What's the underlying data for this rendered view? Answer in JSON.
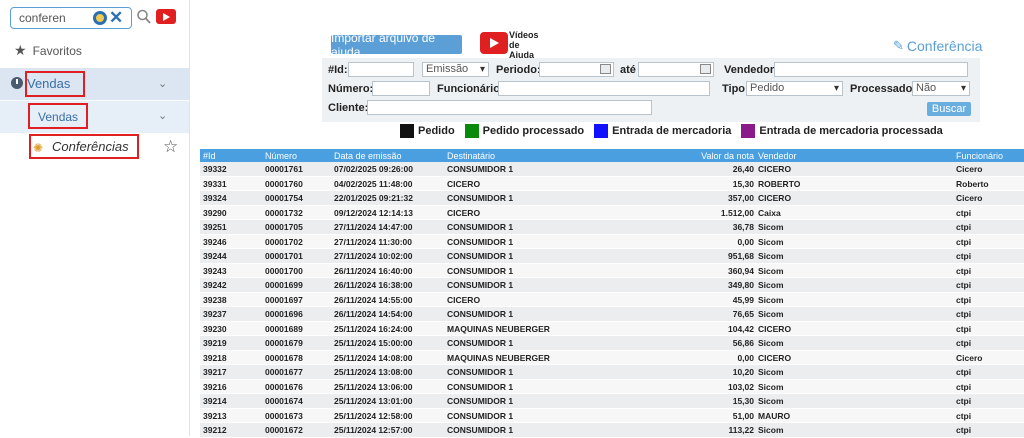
{
  "sidebar": {
    "search_value": "conferen",
    "favoritos": "Favoritos",
    "vendas": "Vendas",
    "vendas_sub": "Vendas",
    "conferencias": "Conferências"
  },
  "toolbar": {
    "import_label": "Importar arquivo de ajuda",
    "videos_line1": "Vídeos",
    "videos_line2": "de Ajuda",
    "conferencia_link": "Conferência"
  },
  "filters": {
    "id_label": "#Id:",
    "emissao_option": "Emissão",
    "periodo_label": "Periodo:",
    "ate_label": "até",
    "vendedor_label": "Vendedor:",
    "numero_label": "Número:",
    "funcionario_label": "Funcionário:",
    "tipo_label": "Tipo:",
    "tipo_value": "Pedido",
    "processado_label": "Processado:",
    "processado_value": "Não",
    "cliente_label": "Cliente:",
    "buscar_label": "Buscar"
  },
  "legend": [
    {
      "label": "Pedido",
      "color": "#111111"
    },
    {
      "label": "Pedido processado",
      "color": "#0a8a0a"
    },
    {
      "label": "Entrada de mercadoria",
      "color": "#1010ff"
    },
    {
      "label": "Entrada de mercadoria processada",
      "color": "#8a1a8a"
    }
  ],
  "table": {
    "headers": {
      "id": "#Id",
      "numero": "Número",
      "data": "Data de emissão",
      "destinatario": "Destinatário",
      "valor": "Valor da nota",
      "vendedor": "Vendedor",
      "funcionario": "Funcionário"
    },
    "rows": [
      [
        "39332",
        "00001761",
        "07/02/2025 09:26:00",
        "CONSUMIDOR 1",
        "26,40",
        "CICERO",
        "Cicero"
      ],
      [
        "39331",
        "00001760",
        "04/02/2025 11:48:00",
        "CICERO",
        "15,30",
        "ROBERTO",
        "Roberto"
      ],
      [
        "39324",
        "00001754",
        "22/01/2025 09:21:32",
        "CONSUMIDOR 1",
        "357,00",
        "CICERO",
        "Cicero"
      ],
      [
        "39290",
        "00001732",
        "09/12/2024 12:14:13",
        "CICERO",
        "1.512,00",
        "Caixa",
        "ctpi"
      ],
      [
        "39251",
        "00001705",
        "27/11/2024 14:47:00",
        "CONSUMIDOR 1",
        "36,78",
        "Sicom",
        "ctpi"
      ],
      [
        "39246",
        "00001702",
        "27/11/2024 11:30:00",
        "CONSUMIDOR 1",
        "0,00",
        "Sicom",
        "ctpi"
      ],
      [
        "39244",
        "00001701",
        "27/11/2024 10:02:00",
        "CONSUMIDOR 1",
        "951,68",
        "Sicom",
        "ctpi"
      ],
      [
        "39243",
        "00001700",
        "26/11/2024 16:40:00",
        "CONSUMIDOR 1",
        "360,94",
        "Sicom",
        "ctpi"
      ],
      [
        "39242",
        "00001699",
        "26/11/2024 16:38:00",
        "CONSUMIDOR 1",
        "349,80",
        "Sicom",
        "ctpi"
      ],
      [
        "39238",
        "00001697",
        "26/11/2024 14:55:00",
        "CICERO",
        "45,99",
        "Sicom",
        "ctpi"
      ],
      [
        "39237",
        "00001696",
        "26/11/2024 14:54:00",
        "CONSUMIDOR 1",
        "76,65",
        "Sicom",
        "ctpi"
      ],
      [
        "39230",
        "00001689",
        "25/11/2024 16:24:00",
        "MAQUINAS NEUBERGER",
        "104,42",
        "CICERO",
        "ctpi"
      ],
      [
        "39219",
        "00001679",
        "25/11/2024 15:00:00",
        "CONSUMIDOR 1",
        "56,86",
        "Sicom",
        "ctpi"
      ],
      [
        "39218",
        "00001678",
        "25/11/2024 14:08:00",
        "MAQUINAS NEUBERGER",
        "0,00",
        "CICERO",
        "Cicero"
      ],
      [
        "39217",
        "00001677",
        "25/11/2024 13:08:00",
        "CONSUMIDOR 1",
        "10,20",
        "Sicom",
        "ctpi"
      ],
      [
        "39216",
        "00001676",
        "25/11/2024 13:06:00",
        "CONSUMIDOR 1",
        "103,02",
        "Sicom",
        "ctpi"
      ],
      [
        "39214",
        "00001674",
        "25/11/2024 13:01:00",
        "CONSUMIDOR 1",
        "15,30",
        "Sicom",
        "ctpi"
      ],
      [
        "39213",
        "00001673",
        "25/11/2024 12:58:00",
        "CONSUMIDOR 1",
        "51,00",
        "MAURO",
        "ctpi"
      ],
      [
        "39212",
        "00001672",
        "25/11/2024 12:57:00",
        "CONSUMIDOR 1",
        "113,22",
        "Sicom",
        "ctpi"
      ]
    ]
  }
}
